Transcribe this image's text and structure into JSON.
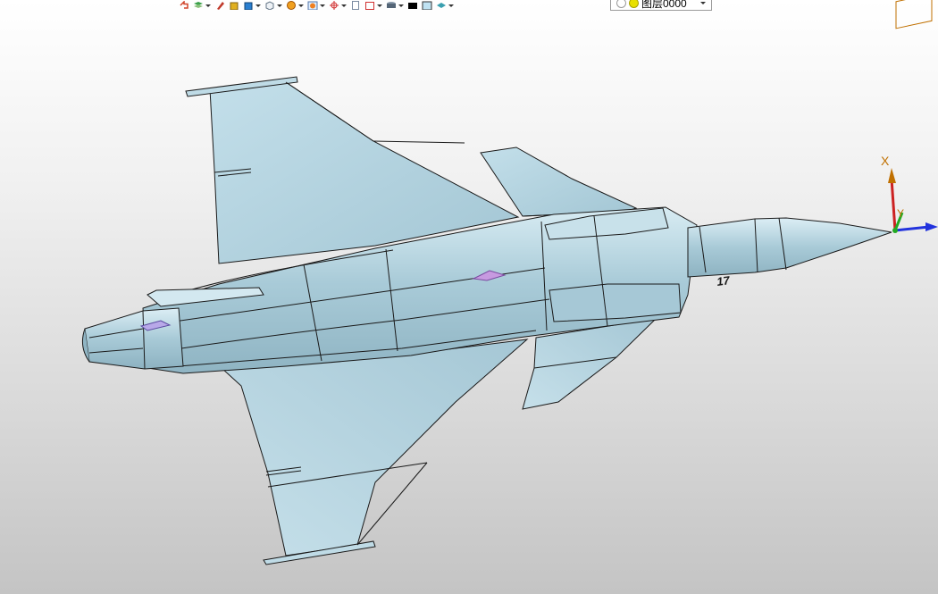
{
  "toolbar": {
    "items": [
      {
        "icon": "undo-icon",
        "color": "#d0442a"
      },
      {
        "icon": "layers-stack-icon",
        "color": "#3aa04a"
      },
      {
        "icon": "pencil-icon",
        "color": "#c0392b"
      },
      {
        "icon": "box-shaded-icon",
        "color": "#e0b020"
      },
      {
        "icon": "box-blue-icon",
        "color": "#2a7fd0"
      },
      {
        "icon": "box-wireframe-icon",
        "color": "#8899aa"
      },
      {
        "icon": "sun-lighting-icon",
        "color": "#f0a020"
      },
      {
        "icon": "render-sphere-icon",
        "color": "#f08020"
      },
      {
        "icon": "snap-crosshair-icon",
        "color": "#d03030"
      },
      {
        "icon": "page-icon",
        "color": "#7a8aa0"
      },
      {
        "icon": "frame-red-icon",
        "color": "#d03030"
      },
      {
        "icon": "cylinder-icon",
        "color": "#556677"
      },
      {
        "icon": "color-black-swatch-icon",
        "color": "#000000"
      },
      {
        "icon": "color-blue-swatch-icon",
        "color": "#bfe2f2"
      },
      {
        "icon": "layer-teal-icon",
        "color": "#3aa0b0"
      }
    ],
    "layer_selector": {
      "value": "图层0000"
    }
  },
  "triad": {
    "x_label": "X",
    "y_label": "Y",
    "x_color": "#cc2222",
    "y_color": "#22aa22",
    "z_color": "#2233dd",
    "label_color": "#c07000"
  },
  "model": {
    "fill_color": "#b2d2df",
    "edge_color": "#1a1a1a",
    "marking": "17"
  }
}
